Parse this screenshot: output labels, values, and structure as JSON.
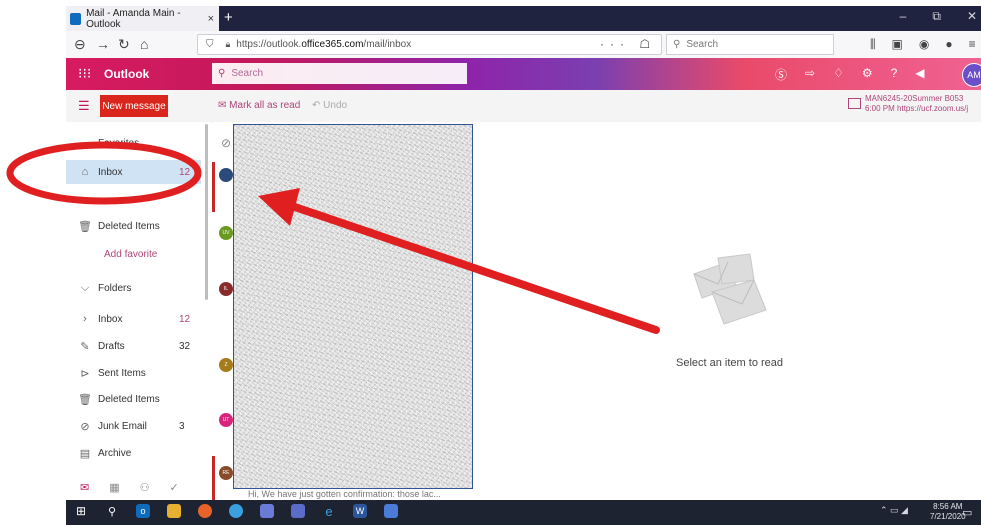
{
  "browser": {
    "tab_title": "Mail - Amanda Main - Outlook",
    "tab_close": "×",
    "new_tab": "+",
    "window_controls": [
      "–",
      "⧉",
      "✕"
    ],
    "url_prefix": "https://outlook.",
    "url_domain": "office365.com",
    "url_suffix": "/mail/inbox",
    "search_placeholder": "Search",
    "url_actions": "··· ☖ ☆"
  },
  "outlook": {
    "brand": "Outlook",
    "search_placeholder": "Search",
    "avatar_initials": "AM"
  },
  "command_bar": {
    "new_message": "New message",
    "mark_all_read": "Mark all as read",
    "undo": "Undo",
    "meeting_line1": "MAN6245-20Summer B053",
    "meeting_line2": "6:00 PM https://ucf.zoom.us/j"
  },
  "nav": {
    "favorites_label": "Favorites",
    "favorites": [
      {
        "label": "Inbox",
        "count": "12"
      },
      {
        "label": "Deleted Items",
        "count": ""
      }
    ],
    "add_favorite": "Add favorite",
    "folders_label": "Folders",
    "folders": [
      {
        "label": "Inbox",
        "count": "12"
      },
      {
        "label": "Drafts",
        "count": "32"
      },
      {
        "label": "Sent Items",
        "count": ""
      },
      {
        "label": "Deleted Items",
        "count": ""
      },
      {
        "label": "Junk Email",
        "count": "3"
      },
      {
        "label": "Archive",
        "count": ""
      }
    ]
  },
  "message_list": {
    "avatars": [
      "UV",
      "IL",
      "Z",
      "UT",
      "RE"
    ],
    "preview_text": "Hi, We have just gotten confirmation: those lac..."
  },
  "reading_pane": {
    "empty_message": "Select an item to read"
  },
  "taskbar": {
    "time": "8:56 AM",
    "date": "7/21/2020"
  },
  "colors": {
    "accent": "#c2185b",
    "new_message_bg": "#d9251c",
    "annotation_red": "#e02020",
    "favorite_selected_bg": "#cfe3f5"
  }
}
